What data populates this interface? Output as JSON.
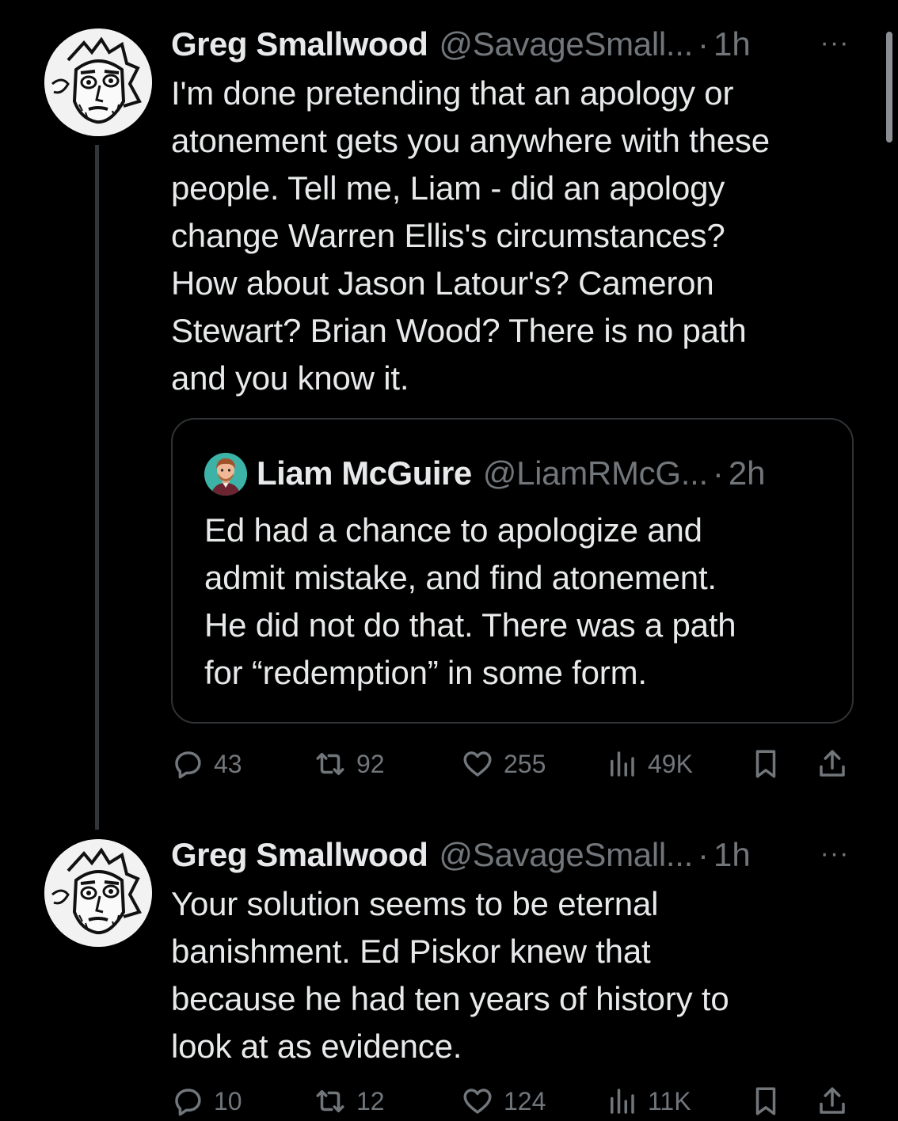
{
  "thread": {
    "posts": [
      {
        "author": {
          "name": "Greg Smallwood",
          "handle": "@SavageSmall...",
          "time": "1h"
        },
        "more_label": "···",
        "text": "I'm done pretending that an apology or\natonement gets you anywhere with these\npeople. Tell me, Liam - did an apology\nchange Warren Ellis's circumstances?\nHow about Jason Latour's? Cameron\nStewart? Brian Wood? There is no path\nand you know it.",
        "quoted": {
          "author": {
            "name": "Liam McGuire",
            "handle": "@LiamRMcG...",
            "time": "2h"
          },
          "text": "Ed had a chance to apologize and\nadmit mistake, and find atonement.\nHe did not do that. There was a path\nfor “redemption” in some form."
        },
        "stats": {
          "replies": "43",
          "reposts": "92",
          "likes": "255",
          "views": "49K"
        }
      },
      {
        "author": {
          "name": "Greg Smallwood",
          "handle": "@SavageSmall...",
          "time": "1h"
        },
        "more_label": "···",
        "text": "Your solution seems to be eternal\nbanishment. Ed Piskor knew that\nbecause he had ten years of history to\nlook at as evidence.",
        "stats": {
          "replies": "10",
          "reposts": "12",
          "likes": "124",
          "views": "11K"
        }
      }
    ],
    "separator": "·"
  },
  "icons": {
    "reply": "reply-icon",
    "repost": "repost-icon",
    "like": "heart-icon",
    "views": "views-icon",
    "bookmark": "bookmark-icon",
    "share": "share-icon"
  },
  "colors": {
    "background": "#000000",
    "text": "#e7e9ea",
    "muted": "#71767b",
    "border": "#2f3336"
  }
}
